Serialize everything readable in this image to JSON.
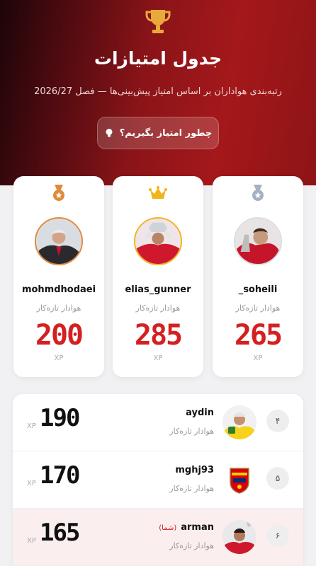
{
  "hero": {
    "title": "جدول امتیازات",
    "subtitle": "رتبه‌بندی هواداران بر اساس امتیاز پیش‌بینی‌ها — فصل 2026/27",
    "how_button": "چطور امتیاز بگیریم؟",
    "trophy_icon": "trophy-icon",
    "bulb_icon": "lightbulb-icon"
  },
  "podium": [
    {
      "place": 1,
      "username": "elias_gunner",
      "rank_title": "هوادار تازه‌کار",
      "points": "285",
      "unit": "XP",
      "badge": "crown-icon",
      "badge_color": "#f2b41c"
    },
    {
      "place": 2,
      "username": "_soheili",
      "rank_title": "هوادار تازه‌کار",
      "points": "265",
      "unit": "XP",
      "badge": "silver-medal-icon",
      "badge_color": "#a7b0c2"
    },
    {
      "place": 3,
      "username": "mohmdhodaei",
      "rank_title": "هوادار تازه‌کار",
      "points": "200",
      "unit": "XP",
      "badge": "bronze-medal-icon",
      "badge_color": "#e08a3c"
    }
  ],
  "leaderboard": [
    {
      "position": "۴",
      "username": "aydin",
      "rank_title": "هوادار تازه‌کار",
      "points": "190",
      "unit": "XP",
      "you_label": ""
    },
    {
      "position": "۵",
      "username": "mghj93",
      "rank_title": "هوادار تازه‌کار",
      "points": "170",
      "unit": "XP",
      "you_label": ""
    },
    {
      "position": "۶",
      "username": "arman",
      "rank_title": "هوادار تازه‌کار",
      "points": "165",
      "unit": "XP",
      "you_label": "(شما)"
    }
  ],
  "colors": {
    "accent": "#d32122",
    "hero": "#a4181a",
    "highlight_row": "#fbeeee"
  }
}
